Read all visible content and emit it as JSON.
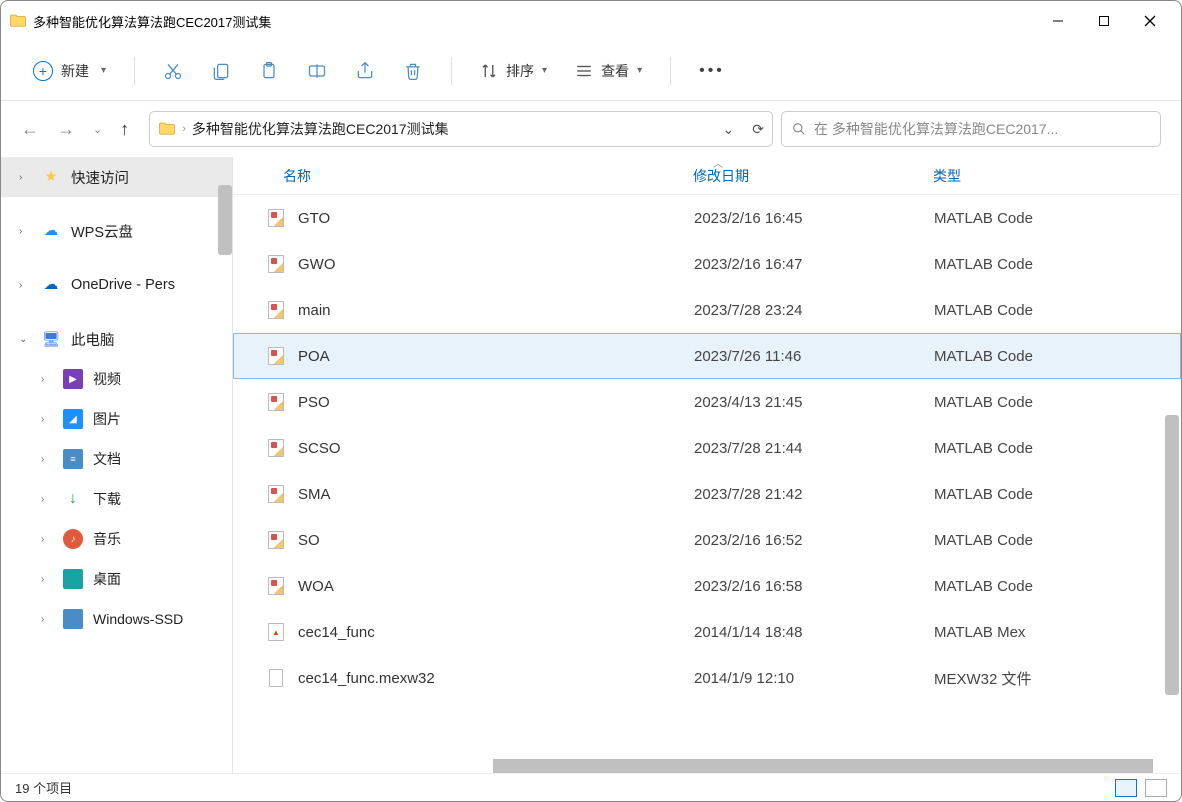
{
  "window": {
    "title": "多种智能优化算法算法跑CEC2017测试集"
  },
  "toolbar": {
    "new_label": "新建",
    "sort_label": "排序",
    "view_label": "查看"
  },
  "breadcrumb": {
    "folder": "多种智能优化算法算法跑CEC2017测试集"
  },
  "search": {
    "placeholder": "在 多种智能优化算法算法跑CEC2017..."
  },
  "sidebar": {
    "quick_access": "快速访问",
    "wps": "WPS云盘",
    "onedrive": "OneDrive - Pers",
    "this_pc": "此电脑",
    "videos": "视频",
    "pictures": "图片",
    "documents": "文档",
    "downloads": "下载",
    "music": "音乐",
    "desktop": "桌面",
    "windows_ssd": "Windows-SSD"
  },
  "columns": {
    "name": "名称",
    "date": "修改日期",
    "type": "类型"
  },
  "files": [
    {
      "name": "GTO",
      "date": "2023/2/16 16:45",
      "type": "MATLAB Code",
      "icon": "matlab"
    },
    {
      "name": "GWO",
      "date": "2023/2/16 16:47",
      "type": "MATLAB Code",
      "icon": "matlab"
    },
    {
      "name": "main",
      "date": "2023/7/28 23:24",
      "type": "MATLAB Code",
      "icon": "matlab"
    },
    {
      "name": "POA",
      "date": "2023/7/26 11:46",
      "type": "MATLAB Code",
      "icon": "matlab",
      "selected": true
    },
    {
      "name": "PSO",
      "date": "2023/4/13 21:45",
      "type": "MATLAB Code",
      "icon": "matlab"
    },
    {
      "name": "SCSO",
      "date": "2023/7/28 21:44",
      "type": "MATLAB Code",
      "icon": "matlab"
    },
    {
      "name": "SMA",
      "date": "2023/7/28 21:42",
      "type": "MATLAB Code",
      "icon": "matlab"
    },
    {
      "name": "SO",
      "date": "2023/2/16 16:52",
      "type": "MATLAB Code",
      "icon": "matlab"
    },
    {
      "name": "WOA",
      "date": "2023/2/16 16:58",
      "type": "MATLAB Code",
      "icon": "matlab"
    },
    {
      "name": "cec14_func",
      "date": "2014/1/14 18:48",
      "type": "MATLAB Mex",
      "icon": "mex"
    },
    {
      "name": "cec14_func.mexw32",
      "date": "2014/1/9 12:10",
      "type": "MEXW32 文件",
      "icon": "plain"
    }
  ],
  "status": {
    "item_count": "19 个项目"
  }
}
